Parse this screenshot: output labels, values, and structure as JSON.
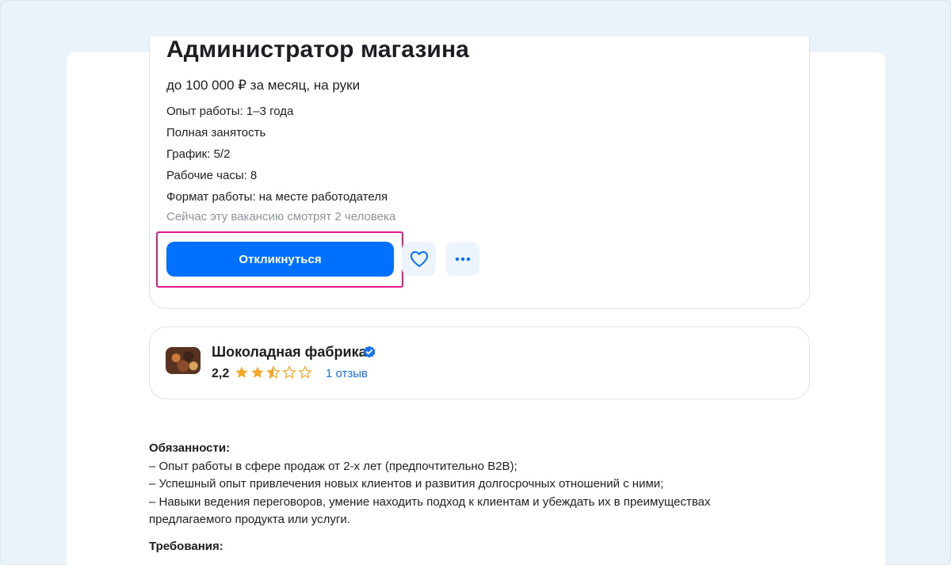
{
  "vacancy": {
    "title": "Администратор магазина",
    "salary": "до 100 000 ₽ за месяц, на руки",
    "experience": "Опыт работы: 1–3 года",
    "employment": "Полная занятость",
    "schedule": "График: 5/2",
    "hours": "Рабочие часы: 8",
    "work_format": "Формат работы: на месте работодателя",
    "watchers": "Сейчас эту вакансию смотрят 2 человека",
    "apply_label": "Откликнуться"
  },
  "company": {
    "name": "Шоколадная фабрика",
    "rating": "2,2",
    "rating_stars": 2.5,
    "rating_max": 5,
    "reviews": "1 отзыв"
  },
  "description": {
    "duties_heading": "Обязанности:",
    "duties": [
      "– Опыт работы в сфере продаж от 2-х лет (предпочтительно B2B);",
      "– Успешный опыт привлечения новых клиентов и развития долгосрочных отношений с ними;",
      "– Навыки ведения переговоров, умение находить подход к клиентам и убеждать их в преимуществах предлагаемого продукта или услуги."
    ],
    "requirements_heading": "Требования:"
  },
  "colors": {
    "accent": "#0070ff",
    "highlight": "#e61a8d",
    "star": "#f5a623",
    "link": "#1a73e8"
  }
}
